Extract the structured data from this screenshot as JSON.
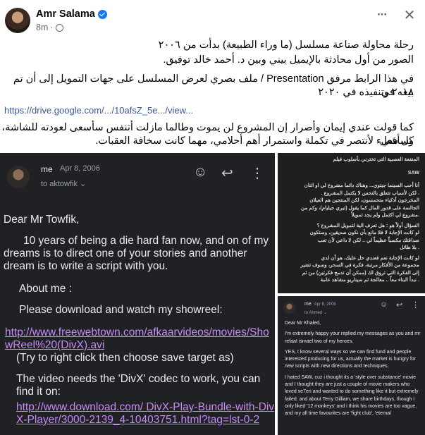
{
  "post": {
    "author": "Amr Salama",
    "time": "8m",
    "more_label": "···",
    "close_label": "✕",
    "text": {
      "line1": "رحلة محاولة صناعة مسلسل (ما وراء الطبيعة) بدأت من ٢٠٠٦",
      "line2": "الصور من أول محادثة بالإيميل بيني وبين د. أحمد خالد توفيق.",
      "line3": "في هذا الرابط مرفق Presentation / ملف بصري لعرض المسلسل على جهات التمويل إلى أن تم بيعه في",
      "line4": "٢٠١٨ وتنفيذه في ٢٠٢٠",
      "link": "https://drive.google.com/.../10afsZ_5e.../view...",
      "line5": "كما قولت عندي إيمان وأصرار إن المشروع لن يموت وطالما مازلت أتنفس سأسعى لعودته للشاشة، وسأفعل",
      "line6": "كل شيء لأنتصر في تكملة واستمرار أهم أحلامي، مهما كانت سخافة العقبات."
    }
  },
  "email1": {
    "from": "me",
    "date": "Apr 8, 2006",
    "to": "to aktowfik",
    "greeting": "Dear Mr Towfik,",
    "para1": "10 years of being a die hard fan now, and on of my dreams is to direct one of your stories and another dream is to write a script with you.",
    "about": "About me :",
    "download": "Please download and watch my showreel:",
    "link1": "http://www.freewebtown.com/afkaarvideos/movies/ShowReel%20(DivX).avi",
    "tip": "(Try to right click then choose save target as)",
    "codec": "The video needs the 'DivX' codec to work, you can find it on:",
    "link2": "http://www.download.com/ DivX-Play-Bundle-with-DivX-Player/3000-2139_4-10403751.html?tag=lst-0-2"
  },
  "email2": {
    "lines": [
      "المنفعة العصبية التي تخترني بأسلوب فيلم",
      "SAW",
      "أنا أحب السينما جيتوي... وهناك دائما مشروع لي او اثنان",
      ". لكن لأسباب تتعلق بالنحس لا يكتمل المشروع .",
      "المخرجون أذكياء متحمسون، لكن المنتجين هم العيلان",
      "الجالسة على قدور المال كما يقول (تيري جيليام)، وكم من",
      ".مشروع لي اكتمل ولم يجد تمويلاً",
      "السؤال أولاً هو : هل تعرف الية لتمويل المشروع ؟",
      "لو كانت الإجابة لا فلا مانع بأن نكون صديقين، وستكون",
      "صداقتك مكسباً عظيماً لي .. لكن لا داعي لأن تعب",
      ". بلا طائل",
      "لو كانت الإجابة نعم فعندي حل عليك، هو أن لدي",
      "مجموعة من الأفكار مرتبة، فكرة في السحر، وسوف تشير",
      "إلى الفكرة التي تروق لك (ممكن أن تدمج فكرتين) من ثم",
      ". نبدأ البناء معاً .. معالجة ثم سيناريو مشاهد عامة"
    ]
  },
  "email3": {
    "from": "me",
    "date": "Apr 8, 2006",
    "to": "to Ahmed",
    "greeting": "Dear Mr Khaled,",
    "p1": "I'm extremely happy your replied my messages as you and mr refaat ismael two of my heroes.",
    "p2": "YES, I know several ways so we can find fund and people interested producing for us, actually the market is hungry for new scripts with new directions and techniques,",
    "p3": "I hated SAW, cuz i thought its a 'style over substance' movie and I thought they are just a couple of movie makers who loved se7en and wanted to do something like it but extremely failed. and about Terry Gilliam, we share birthdays, though i only liked '12 monkeys' and i think his movies are too vague, and my all time favourites are 'fight club', 'eternal"
  }
}
